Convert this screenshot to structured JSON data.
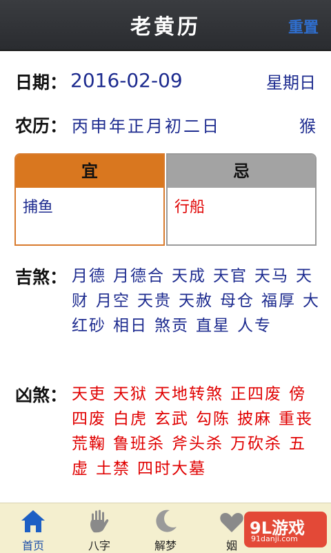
{
  "header": {
    "title": "老黄历",
    "reset_label": "重置"
  },
  "date": {
    "label": "日期：",
    "value": "2016-02-09",
    "weekday": "星期日"
  },
  "lunar": {
    "label": "农历：",
    "value": "丙申年正月初二日",
    "zodiac": "猴"
  },
  "yi": {
    "title": "宜",
    "items": "捕鱼"
  },
  "ji": {
    "title": "忌",
    "items": "行船"
  },
  "good_gods": {
    "label": "吉煞：",
    "items": [
      "月德",
      "月德合",
      "天成",
      "天官",
      "天马",
      "天财",
      "月空",
      "天贵",
      "天赦",
      "母仓",
      "福厚",
      "大红砂",
      "相日",
      "煞贡",
      "直星",
      "人专"
    ]
  },
  "bad_gods": {
    "label": "凶煞：",
    "items": [
      "天吏",
      "天狱",
      "天地转煞",
      "正四废",
      "傍四废",
      "白虎",
      "玄武",
      "勾陈",
      "披麻",
      "重丧",
      "荒鞠",
      "鲁班杀",
      "斧头杀",
      "万砍杀",
      "五虚",
      "土禁",
      "四时大墓"
    ]
  },
  "tabs": [
    {
      "label": "首页",
      "icon": "home-icon"
    },
    {
      "label": "八字",
      "icon": "hand-icon"
    },
    {
      "label": "解梦",
      "icon": "moon-icon"
    },
    {
      "label": "姻",
      "icon": "heart-icon"
    }
  ],
  "watermark": {
    "brand": "9L游戏",
    "url": "91danji.com"
  },
  "colors": {
    "accent_blue": "#1d2b8f",
    "red": "#e00000",
    "orange": "#d9771f",
    "tab_bg": "#f4efcf"
  }
}
